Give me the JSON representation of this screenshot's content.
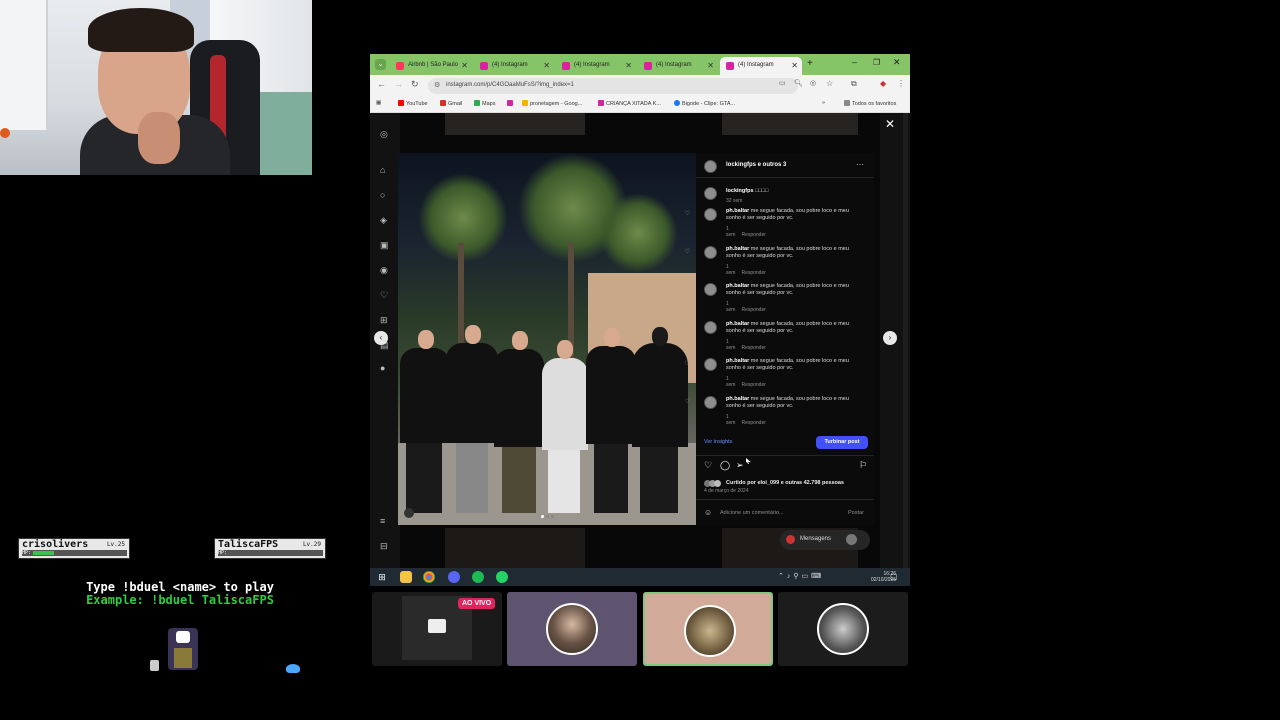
{
  "overlay": {
    "player1": {
      "name": "crisolivers",
      "level": "Lv.25",
      "hp_label": "HP:",
      "hp_fraction": 0.22
    },
    "player2": {
      "name": "TaliscaFPS",
      "level": "Lv.29",
      "hp_label": "HP:",
      "hp_fraction": 0.0
    },
    "instruction": "Type !bduel <name> to play",
    "example": "Example: !bduel TaliscaFPS"
  },
  "browser": {
    "tabs": [
      {
        "label": "Airbnb | São Paulo",
        "close": "✕"
      },
      {
        "label": "(4) Instagram",
        "close": "✕"
      },
      {
        "label": "(4) Instagram",
        "close": "✕"
      },
      {
        "label": "(4) Instagram",
        "close": "✕"
      },
      {
        "label": "(4) Instagram",
        "close": "✕"
      }
    ],
    "new_tab": "+",
    "url": "instagram.com/p/C4GOaaMuFsS/?img_index=1",
    "bookmarks": [
      {
        "label": "YouTube",
        "color": "#ff0000"
      },
      {
        "label": "Gmail",
        "color": "#d93025"
      },
      {
        "label": "Maps",
        "color": "#34a853"
      },
      {
        "label": "",
        "color": "#d6249f"
      },
      {
        "label": "pronetagem - Goog...",
        "color": "#f4b400"
      },
      {
        "label": "CRIANÇA XITADA K...",
        "color": "#d6249f"
      },
      {
        "label": "Bigode - Clipe: GTA...",
        "color": "#1877f2"
      }
    ],
    "bookmarks_more": "»",
    "all_bookmarks": "Todos os favoritos"
  },
  "post": {
    "header_user": "lockingfps e outros 3",
    "caption_user": "lockingfps",
    "caption_text": "□□□□",
    "caption_time": "32 sem",
    "comments": [
      {
        "user": "ph.baltar",
        "text": "me segue facada, sou pobre loco e meu sonho é ser seguido por vc.",
        "time": "1 sem",
        "reply": "Responder"
      },
      {
        "user": "ph.baltar",
        "text": "me segue facada, sou pobre loco e meu sonho é ser seguido por vc.",
        "time": "1 sem",
        "reply": "Responder"
      },
      {
        "user": "ph.baltar",
        "text": "me segue facada, sou pobre loco e meu sonho é ser seguido por vc.",
        "time": "1 sem",
        "reply": "Responder"
      },
      {
        "user": "ph.baltar",
        "text": "me segue facada, sou pobre loco e meu sonho é ser seguido por vc.",
        "time": "1 sem",
        "reply": "Responder"
      },
      {
        "user": "ph.baltar",
        "text": "me segue facada, sou pobre loco e meu sonho é ser seguido por vc.",
        "time": "1 sem",
        "reply": "Responder"
      },
      {
        "user": "ph.baltar",
        "text": "me segue facada, sou pobre loco e meu sonho é ser seguido por vc.",
        "time": "1 sem",
        "reply": "Responder"
      }
    ],
    "insights": "Ver insights",
    "boost": "Turbinar post",
    "likes": "Curtido por eloi_099 e outras 42.798 pessoas",
    "date": "4 de março de 2024",
    "comment_placeholder": "Adicione um comentário...",
    "post_button": "Postar",
    "messages": "Mensagens"
  },
  "taskbar": {
    "time": "16:26",
    "date": "02/10/2025"
  },
  "thumbnails": {
    "live_badge": "AO VIVO"
  },
  "colors": {
    "tab_bar": "#86c468",
    "boost_button": "#4150f7",
    "live_badge": "#e0245e",
    "hp_fill": "#3fbf4f",
    "example_text": "#2ecc40"
  }
}
